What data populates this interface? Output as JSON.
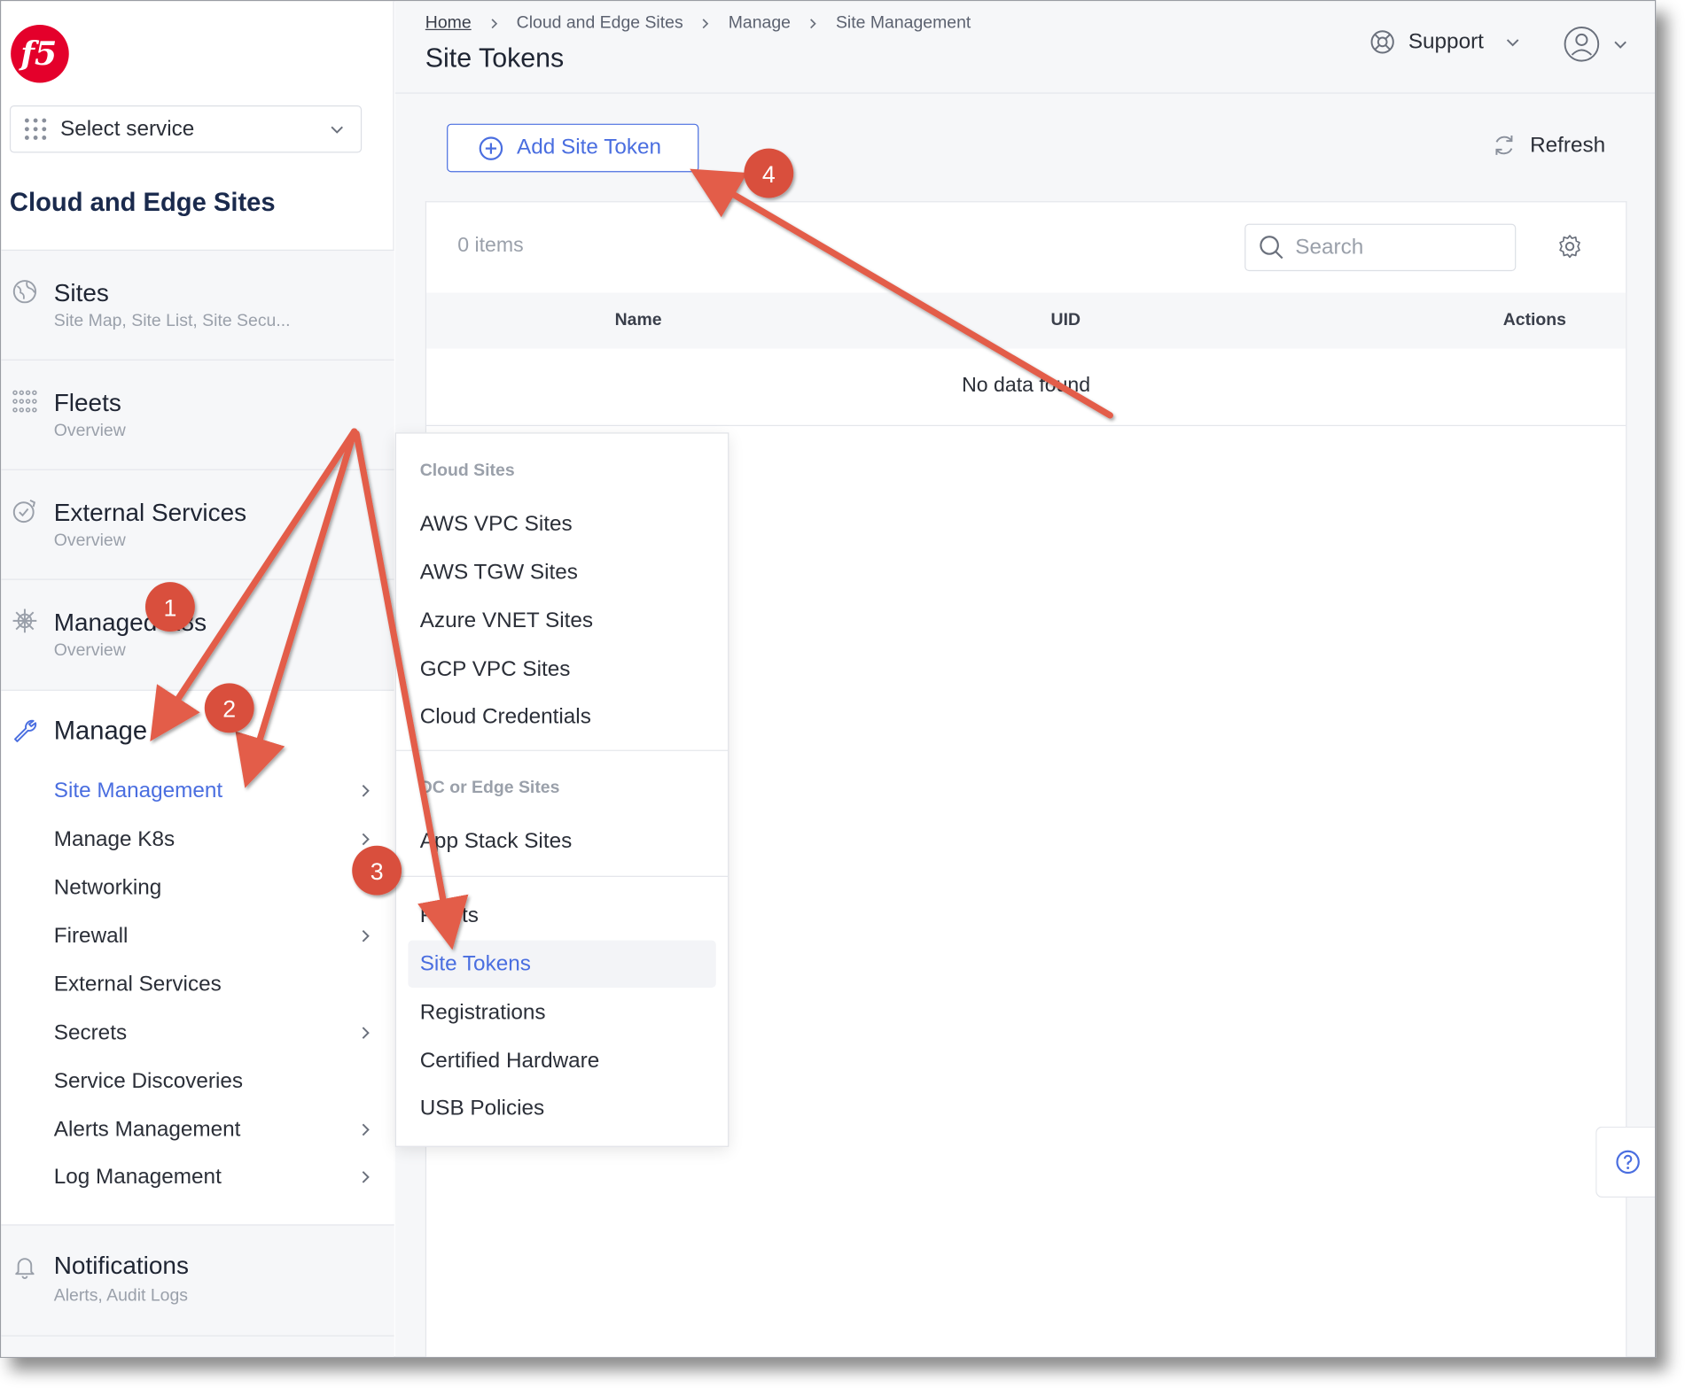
{
  "sidebar": {
    "service_select_label": "Select service",
    "section_title": "Cloud and Edge Sites",
    "groups": [
      {
        "title": "Sites",
        "subtitle": "Site Map, Site List, Site Secu..."
      },
      {
        "title": "Fleets",
        "subtitle": "Overview"
      },
      {
        "title": "External Services",
        "subtitle": "Overview"
      },
      {
        "title": "Managed K8s",
        "subtitle": "Overview"
      },
      {
        "title": "Notifications",
        "subtitle": "Alerts, Audit Logs"
      }
    ],
    "manage": {
      "title": "Manage",
      "items": [
        {
          "label": "Site Management"
        },
        {
          "label": "Manage K8s"
        },
        {
          "label": "Networking"
        },
        {
          "label": "Firewall"
        },
        {
          "label": "External Services"
        },
        {
          "label": "Secrets"
        },
        {
          "label": "Service Discoveries"
        },
        {
          "label": "Alerts Management"
        },
        {
          "label": "Log Management"
        }
      ]
    }
  },
  "header": {
    "breadcrumb": [
      "Home",
      "Cloud and Edge Sites",
      "Manage",
      "Site Management"
    ],
    "title": "Site Tokens",
    "support_label": "Support"
  },
  "toolbar": {
    "add_label": "Add Site Token",
    "refresh_label": "Refresh"
  },
  "table": {
    "count_label": "0 items",
    "search_placeholder": "Search",
    "columns": [
      "Name",
      "UID",
      "Actions"
    ],
    "empty_message": "No data found"
  },
  "dropdown": {
    "sections": [
      {
        "heading": "Cloud Sites",
        "items": [
          "AWS VPC Sites",
          "AWS TGW Sites",
          "Azure VNET Sites",
          "GCP VPC Sites",
          "Cloud Credentials"
        ]
      },
      {
        "heading": "DC or Edge Sites",
        "items": [
          "App Stack Sites"
        ]
      },
      {
        "heading": "",
        "items": [
          "Fleets",
          "Site Tokens",
          "Registrations",
          "Certified Hardware",
          "USB Policies"
        ]
      }
    ]
  },
  "annotations": {
    "badges": [
      "1",
      "2",
      "3",
      "4"
    ],
    "color": "#e35d4a"
  },
  "colors": {
    "accent": "#4a6ee0",
    "brand": "#e4002b",
    "annotation": "#e35d4a"
  }
}
